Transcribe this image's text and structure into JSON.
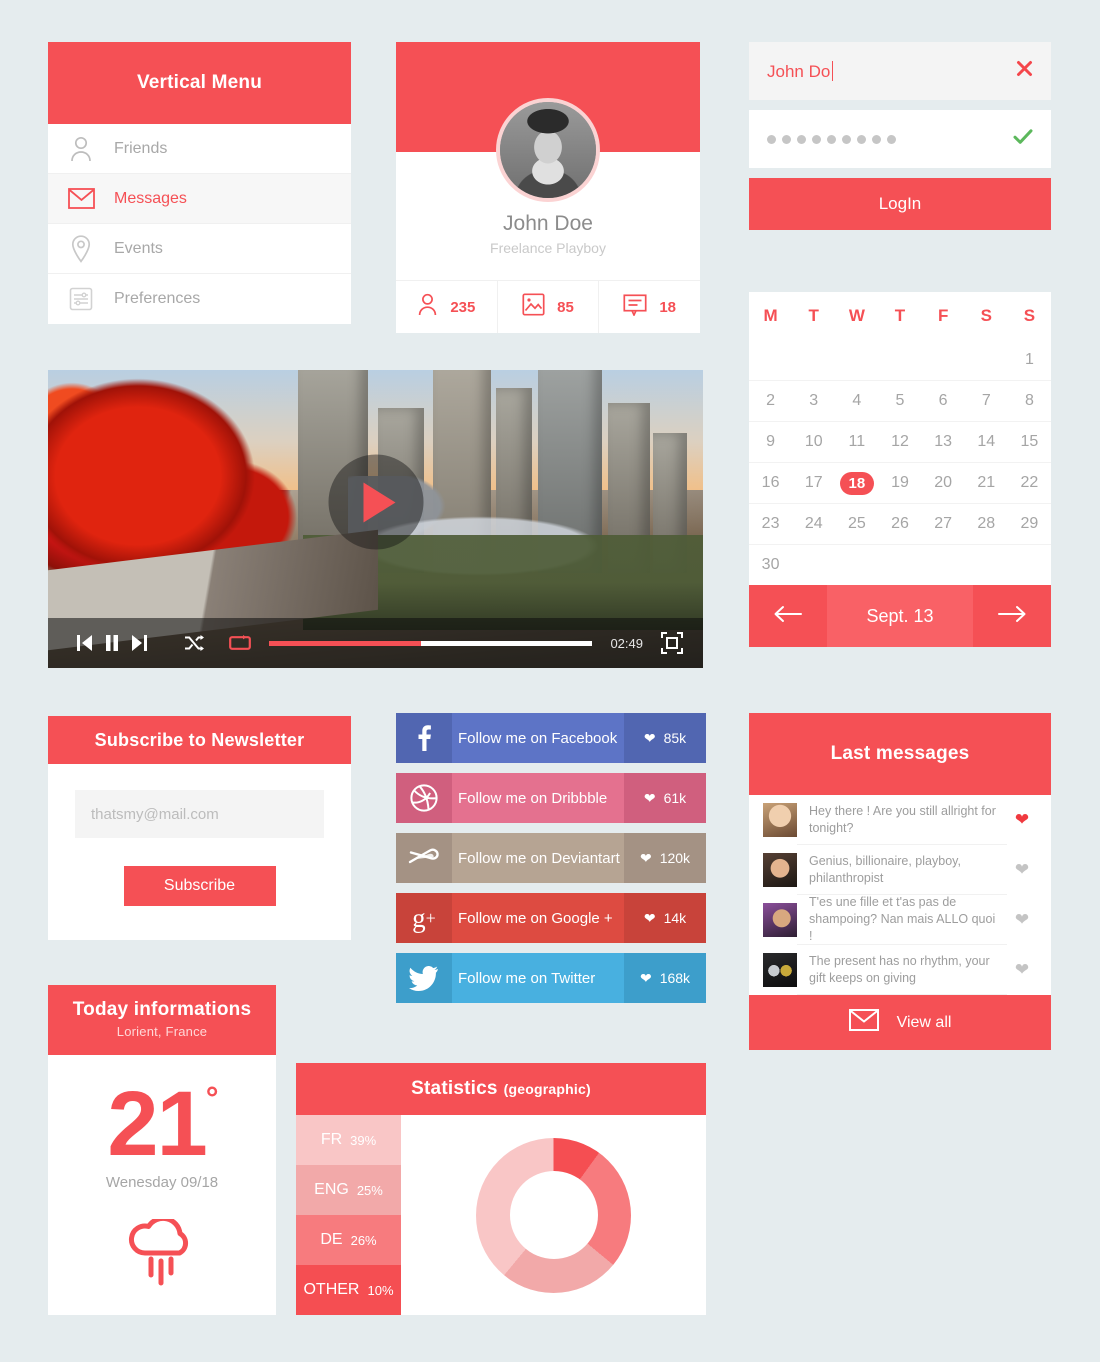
{
  "theme": {
    "primary": "#f55055",
    "primary_light": "#f96166",
    "background": "#e5ecee",
    "muted_text": "#a8a8a8",
    "success": "#5cb85c"
  },
  "vertical_menu": {
    "title": "Vertical Menu",
    "items": [
      {
        "label": "Friends",
        "icon": "user-icon",
        "active": false
      },
      {
        "label": "Messages",
        "icon": "envelope-icon",
        "active": true
      },
      {
        "label": "Events",
        "icon": "map-pin-icon",
        "active": false
      },
      {
        "label": "Preferences",
        "icon": "sliders-icon",
        "active": false
      }
    ]
  },
  "profile": {
    "name": "John Doe",
    "title": "Freelance Playboy",
    "avatar_alt": "bearded-man-avatar",
    "stats": [
      {
        "icon": "user-icon",
        "value": "235"
      },
      {
        "icon": "photo-icon",
        "value": "85"
      },
      {
        "icon": "comment-icon",
        "value": "18"
      }
    ]
  },
  "login": {
    "username_value": "John Do",
    "username_clear_icon": "close-icon",
    "password_value": "●●●●●●●●●",
    "password_dots": 9,
    "password_valid_icon": "check-icon",
    "submit_label": "LogIn"
  },
  "calendar": {
    "weekdays": [
      "M",
      "T",
      "W",
      "T",
      "F",
      "S",
      "S"
    ],
    "weeks": [
      [
        "",
        "",
        "",
        "",
        "",
        "",
        "1"
      ],
      [
        "2",
        "3",
        "4",
        "5",
        "6",
        "7",
        "8"
      ],
      [
        "9",
        "10",
        "11",
        "12",
        "13",
        "14",
        "15"
      ],
      [
        "16",
        "17",
        "18",
        "19",
        "20",
        "21",
        "22"
      ],
      [
        "23",
        "24",
        "25",
        "26",
        "27",
        "28",
        "29"
      ],
      [
        "30",
        "",
        "",
        "",
        "",
        "",
        ""
      ]
    ],
    "selected_day": "18",
    "month_label": "Sept. 13",
    "prev_icon": "arrow-left-icon",
    "next_icon": "arrow-right-icon"
  },
  "player": {
    "scene_alt": "city-skyline-autumn-park-sunset",
    "play_icon": "play-icon",
    "prev_icon": "skip-previous-icon",
    "pause_icon": "pause-icon",
    "next_icon": "skip-next-icon",
    "shuffle_icon": "shuffle-icon",
    "repeat_icon": "repeat-icon",
    "fullscreen_icon": "fullscreen-icon",
    "time": "02:49",
    "progress_percent": 47,
    "repeat_active": true
  },
  "newsletter": {
    "title": "Subscribe to Newsletter",
    "email_placeholder": "thatsmy@mail.com",
    "email_value": "",
    "submit_label": "Subscribe"
  },
  "social": [
    {
      "network": "facebook",
      "icon": "facebook-icon",
      "label": "Follow me on Facebook",
      "count": "85k",
      "heart_icon": "heart-icon",
      "color": "#5d74c6",
      "color_dark": "#5166b1",
      "color_icon": "#5166b1"
    },
    {
      "network": "dribbble",
      "icon": "dribbble-icon",
      "label": "Follow me on Dribbble",
      "count": "61k",
      "heart_icon": "heart-icon",
      "color": "#e4718f",
      "color_dark": "#d05f7e",
      "color_icon": "#d05f7e"
    },
    {
      "network": "deviantart",
      "icon": "deviantart-icon",
      "label": "Follow me on Deviantart",
      "count": "120k",
      "heart_icon": "heart-icon",
      "color": "#b6a493",
      "color_dark": "#a49284",
      "color_icon": "#a49284"
    },
    {
      "network": "googleplus",
      "icon": "google-plus-icon",
      "label": "Follow me on Google +",
      "count": "14k",
      "heart_icon": "heart-icon",
      "color": "#dd4b41",
      "color_dark": "#c8433a",
      "color_icon": "#c8433a"
    },
    {
      "network": "twitter",
      "icon": "twitter-icon",
      "label": "Follow me on Twitter",
      "count": "168k",
      "heart_icon": "heart-icon",
      "color": "#48b0e0",
      "color_dark": "#3d9ecb",
      "color_icon": "#3d9ecb"
    }
  ],
  "last_messages": {
    "title": "Last messages",
    "items": [
      {
        "text": "Hey there ! Are you still allright for tonight?",
        "avatar_alt": "woman-blonde-avatar",
        "liked": true
      },
      {
        "text": "Genius, billionaire, playboy, philanthropist",
        "avatar_alt": "man-dark-hair-avatar",
        "liked": false
      },
      {
        "text": "T'es une fille et t'as pas de shampoing? Nan mais ALLO quoi !",
        "avatar_alt": "woman-brunette-avatar",
        "liked": false
      },
      {
        "text": "The present has no rhythm, your gift keeps on giving",
        "avatar_alt": "daft-punk-helmets-avatar",
        "liked": false
      }
    ],
    "view_all_label": "View all",
    "view_all_icon": "envelope-icon"
  },
  "weather": {
    "title": "Today informations",
    "location": "Lorient, France",
    "temperature": "21",
    "degree_symbol": "°",
    "date": "Wenesday 09/18",
    "icon": "rain-cloud-icon"
  },
  "chart_data": {
    "type": "pie",
    "title": "Statistics",
    "subtitle": "(geographic)",
    "categories": [
      "FR",
      "ENG",
      "DE",
      "OTHER"
    ],
    "values": [
      39,
      25,
      26,
      10
    ],
    "labels": [
      "39%",
      "25%",
      "26%",
      "10%"
    ],
    "colors": [
      "#f9c6c6",
      "#f2a9a9",
      "#f77b7e",
      "#f54e52"
    ],
    "donut": true,
    "legend": "left",
    "segment_order_clockwise_from_top": [
      "OTHER",
      "DE",
      "ENG",
      "FR"
    ]
  }
}
